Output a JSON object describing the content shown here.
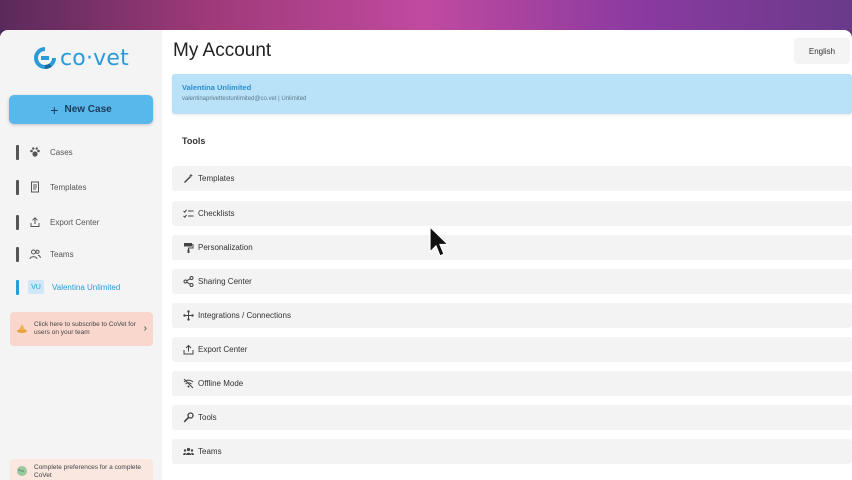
{
  "sidebar": {
    "logo_text": "co·vet",
    "new_case_label": "New Case",
    "items": [
      {
        "label": "Cases",
        "icon": "paw-icon"
      },
      {
        "label": "Templates",
        "icon": "document-icon"
      },
      {
        "label": "Export Center",
        "icon": "export-icon"
      },
      {
        "label": "Teams",
        "icon": "users-icon"
      },
      {
        "label": "Valentina Unlimited",
        "icon": "avatar",
        "initials": "VU",
        "active": true
      }
    ],
    "promo_text": "Click here to subscribe to CoVet for users on your team",
    "preferences_text": "Complete preferences for a complete CoVet"
  },
  "header": {
    "title": "My Account",
    "language": "English"
  },
  "account": {
    "name": "Valentina Unlimited",
    "details": "valentinaprivettestunlimited@co.vet | Unlimited"
  },
  "tools": {
    "title": "Tools",
    "items": [
      {
        "label": "Templates",
        "icon": "wand-icon"
      },
      {
        "label": "Checklists",
        "icon": "checklist-icon"
      },
      {
        "label": "Personalization",
        "icon": "paint-roller-icon"
      },
      {
        "label": "Sharing Center",
        "icon": "share-icon"
      },
      {
        "label": "Integrations / Connections",
        "icon": "connections-icon"
      },
      {
        "label": "Export Center",
        "icon": "export-icon"
      },
      {
        "label": "Offline Mode",
        "icon": "wifi-off-icon"
      },
      {
        "label": "Tools",
        "icon": "wrench-icon"
      },
      {
        "label": "Teams",
        "icon": "team-icon"
      }
    ]
  },
  "colors": {
    "accent": "#2a9bd8",
    "new_case_bg": "#58b8ec",
    "account_bg": "#b9e2f9",
    "promo_bg": "#f9d7cc"
  }
}
